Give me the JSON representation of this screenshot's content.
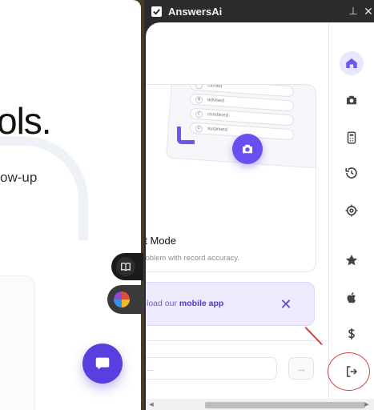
{
  "background_page": {
    "headline": "ols.",
    "subtext": "ow-up"
  },
  "window": {
    "title": "AnswersAi",
    "pin_glyph": "⊥",
    "close_glyph": "✕"
  },
  "feature_card": {
    "title": "ot Mode",
    "description": "problem with record accuracy.",
    "mock_rows": [
      {
        "num": "",
        "label": "carried"
      },
      {
        "num": "B",
        "label": "advised"
      },
      {
        "num": "C",
        "label": "combined"
      },
      {
        "num": "D",
        "label": "surprised"
      }
    ]
  },
  "mobile_banner": {
    "prefix": "load our ",
    "link": "mobile app",
    "close_glyph": "✕"
  },
  "chat": {
    "placeholder": "...",
    "send_glyph": "→"
  },
  "sidebar": {
    "items": [
      {
        "name": "home",
        "icon": "home-icon",
        "active": true
      },
      {
        "name": "camera",
        "icon": "camera-icon"
      },
      {
        "name": "calculator",
        "icon": "calculator-icon"
      },
      {
        "name": "history",
        "icon": "history-icon"
      },
      {
        "name": "settings",
        "icon": "settings-icon"
      },
      {
        "name": "favorites",
        "icon": "star-icon"
      },
      {
        "name": "apple",
        "icon": "apple-icon"
      },
      {
        "name": "pricing",
        "icon": "dollar-icon"
      },
      {
        "name": "logout",
        "icon": "logout-icon"
      }
    ]
  },
  "colors": {
    "accent": "#6a4ef0",
    "annotation": "#d64040",
    "banner_bg": "#eeebff"
  }
}
